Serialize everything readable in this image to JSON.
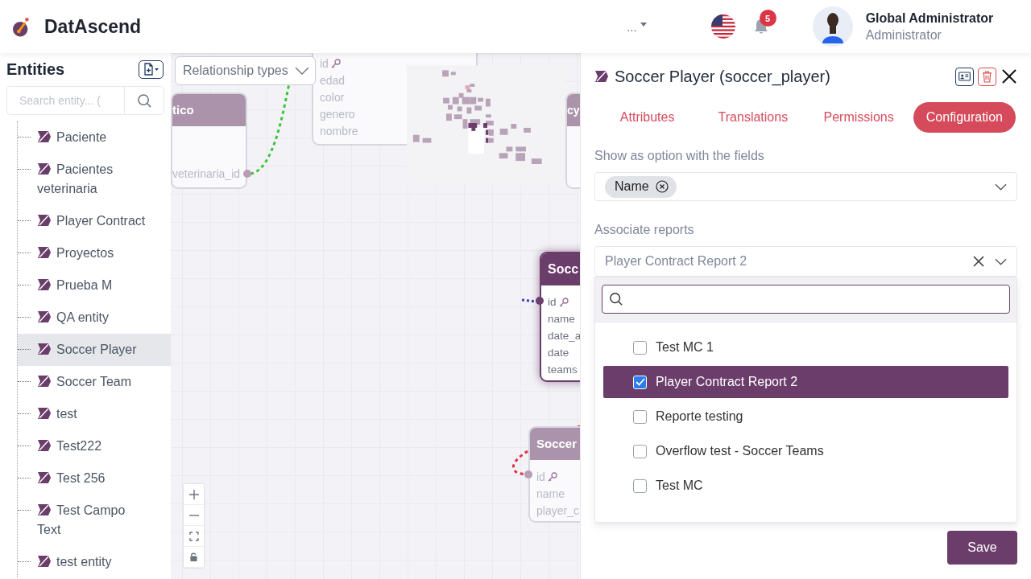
{
  "app": {
    "name": "DatAscend"
  },
  "header": {
    "menu_label": "...",
    "notification_count": "5",
    "user": {
      "name": "Global Administrator",
      "role": "Administrator"
    }
  },
  "sidebar": {
    "title": "Entities",
    "search": {
      "placeholder": "Search entity... ("
    },
    "items": [
      {
        "label": "Paciente",
        "selected": false
      },
      {
        "label": "Pacientes veterinaria",
        "selected": false
      },
      {
        "label": "Player Contract",
        "selected": false
      },
      {
        "label": "Proyectos",
        "selected": false
      },
      {
        "label": "Prueba M",
        "selected": false
      },
      {
        "label": "QA entity",
        "selected": false
      },
      {
        "label": "Soccer Player",
        "selected": true
      },
      {
        "label": "Soccer Team",
        "selected": false
      },
      {
        "label": "test",
        "selected": false
      },
      {
        "label": "Test222",
        "selected": false
      },
      {
        "label": "Test 256",
        "selected": false
      },
      {
        "label": "Test Campo Text",
        "selected": false
      },
      {
        "label": "test entity",
        "selected": false
      }
    ]
  },
  "canvas": {
    "relationship_filter": {
      "label": "Relationship types"
    },
    "nodes": [
      {
        "title": "tico",
        "selected": false,
        "fields": [
          {
            "name": "veterinaria_id",
            "key": false
          }
        ]
      },
      {
        "selected": false,
        "fields": [
          {
            "name": "id",
            "key": true
          },
          {
            "name": "edad",
            "key": false
          },
          {
            "name": "color",
            "key": false
          },
          {
            "name": "genero",
            "key": false
          },
          {
            "name": "nombre",
            "key": false
          }
        ]
      },
      {
        "title": "cy",
        "selected": false
      },
      {
        "title": "Socc",
        "selected": true,
        "fields": [
          {
            "name": "id",
            "key": true
          },
          {
            "name": "name",
            "key": false
          },
          {
            "name": "date_a",
            "key": false
          },
          {
            "name": "date",
            "key": false
          },
          {
            "name": "teams",
            "key": false
          }
        ]
      },
      {
        "title": "Soccer",
        "selected": false,
        "fields": [
          {
            "name": "id",
            "key": true
          },
          {
            "name": "name",
            "key": false
          },
          {
            "name": "player_c",
            "key": false
          }
        ]
      }
    ]
  },
  "panel": {
    "title": "Soccer Player (soccer_player)",
    "tabs": [
      {
        "label": "Attributes",
        "selected": false
      },
      {
        "label": "Translations",
        "selected": false
      },
      {
        "label": "Permissions",
        "selected": false
      },
      {
        "label": "Configuration",
        "selected": true
      }
    ],
    "fields": [
      {
        "kind": "tags",
        "label": "Show as option with the fields",
        "tags": [
          "Name"
        ]
      },
      {
        "kind": "select",
        "label": "Associate reports",
        "value": "Player Contract Report 2"
      }
    ],
    "dropdown": {
      "options": [
        {
          "label": "Test MC 1",
          "checked": false,
          "selected": false
        },
        {
          "label": "Player Contract Report 2",
          "checked": true,
          "selected": true
        },
        {
          "label": "Reporte testing",
          "checked": false,
          "selected": false
        },
        {
          "label": "Overflow test - Soccer Teams",
          "checked": false,
          "selected": false
        },
        {
          "label": "Test MC",
          "checked": false,
          "selected": false
        }
      ]
    },
    "save_label": "Save"
  }
}
